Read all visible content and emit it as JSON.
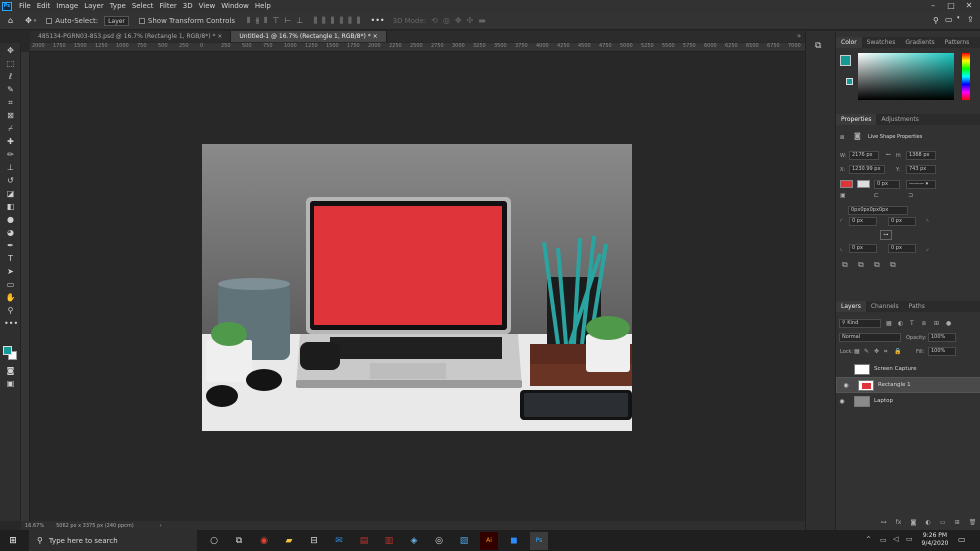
{
  "menubar": {
    "logo": "Ps",
    "items": [
      "File",
      "Edit",
      "Image",
      "Layer",
      "Type",
      "Select",
      "Filter",
      "3D",
      "View",
      "Window",
      "Help"
    ],
    "window_controls": [
      "–",
      "□",
      "✕"
    ]
  },
  "options": {
    "auto_select_label": "Auto-Select:",
    "auto_select_value": "Layer",
    "show_transform_label": "Show Transform Controls",
    "mode_3d": "3D Mode:"
  },
  "tabs": [
    {
      "label": "485134-PGRN03-853.psd @ 16.7% (Rectangle 1, RGB/8*) *  ×",
      "active": false
    },
    {
      "label": "Untitled-1 @ 16.7% (Rectangle 1, RGB/8*) *  ×",
      "active": true
    }
  ],
  "ruler_ticks": [
    "2000",
    "1750",
    "1500",
    "1250",
    "1000",
    "750",
    "500",
    "250",
    "0",
    "250",
    "500",
    "750",
    "1000",
    "1250",
    "1500",
    "1750",
    "2000",
    "2250",
    "2500",
    "2750",
    "3000",
    "3250",
    "3500",
    "3750",
    "4000",
    "4250",
    "4500",
    "4750",
    "5000",
    "5250",
    "5500",
    "5750",
    "6000",
    "6250",
    "6500",
    "6750",
    "7000"
  ],
  "status": {
    "zoom": "16.67%",
    "doc_size": "5062 px x 3375 px (240 ppcm)"
  },
  "panels": {
    "color_tabs": [
      "Color",
      "Swatches",
      "Gradients",
      "Patterns"
    ],
    "props_tabs": [
      "Properties",
      "Adjustments"
    ],
    "live_shape": "Live Shape Properties",
    "w_label": "W:",
    "w_value": "2176 px",
    "h_label": "H:",
    "h_value": "1368 px",
    "x_label": "X:",
    "x_value": "1230.99 px",
    "y_label": "Y:",
    "y_value": "743 px",
    "stroke_value": "0 px",
    "corner_link_value": "0px0px0px0px",
    "corner_tl": "0 px",
    "corner_tr": "0 px",
    "corner_bl": "0 px",
    "corner_br": "0 px",
    "layers_tabs": [
      "Layers",
      "Channels",
      "Paths"
    ],
    "kind_value": "Kind",
    "blend_value": "Normal",
    "opacity_label": "Opacity:",
    "opacity_value": "100%",
    "lock_label": "Lock:",
    "fill_label": "Fill:",
    "fill_value": "100%",
    "layers": [
      {
        "name": "Screen Capture",
        "visible": false,
        "selected": false
      },
      {
        "name": "Rectangle 1",
        "visible": true,
        "selected": true
      },
      {
        "name": "Laptop",
        "visible": true,
        "selected": false
      }
    ]
  },
  "taskbar": {
    "search_placeholder": "Type here to search",
    "time": "9:26 PM",
    "date": "9/4/2020"
  },
  "colors": {
    "foreground": "#169a95",
    "background": "#ffffff",
    "screen_red": "#e0343b",
    "accent_blue": "#31a8ff"
  },
  "icons": [
    "home-icon",
    "move-icon",
    "marquee-icon",
    "lasso-icon",
    "quick-select-icon",
    "crop-icon",
    "frame-icon",
    "eyedropper-icon",
    "healing-icon",
    "brush-icon",
    "stamp-icon",
    "history-brush-icon",
    "eraser-icon",
    "gradient-icon",
    "blur-icon",
    "dodge-icon",
    "pen-icon",
    "type-icon",
    "path-select-icon",
    "shape-icon",
    "hand-icon",
    "zoom-icon",
    "more-icon"
  ]
}
